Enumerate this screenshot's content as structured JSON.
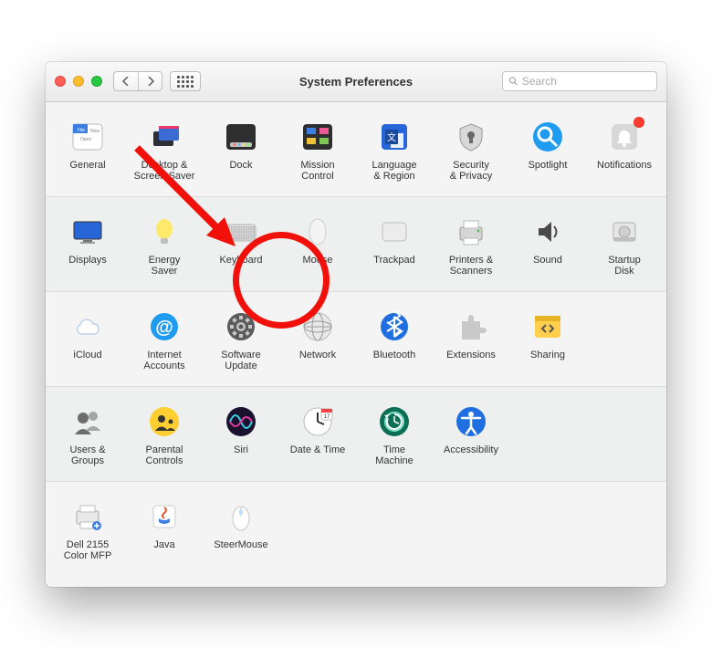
{
  "window": {
    "title": "System Preferences"
  },
  "search": {
    "placeholder": "Search"
  },
  "rows": [
    [
      {
        "key": "general",
        "label": "General"
      },
      {
        "key": "desktop",
        "label": "Desktop &\nScreen Saver"
      },
      {
        "key": "dock",
        "label": "Dock"
      },
      {
        "key": "mission",
        "label": "Mission\nControl"
      },
      {
        "key": "language",
        "label": "Language\n& Region"
      },
      {
        "key": "security",
        "label": "Security\n& Privacy"
      },
      {
        "key": "spotlight",
        "label": "Spotlight"
      },
      {
        "key": "notifications",
        "label": "Notifications",
        "badge": true
      }
    ],
    [
      {
        "key": "displays",
        "label": "Displays"
      },
      {
        "key": "energy",
        "label": "Energy\nSaver"
      },
      {
        "key": "keyboard",
        "label": "Keyboard"
      },
      {
        "key": "mouse",
        "label": "Mouse"
      },
      {
        "key": "trackpad",
        "label": "Trackpad"
      },
      {
        "key": "printers",
        "label": "Printers &\nScanners"
      },
      {
        "key": "sound",
        "label": "Sound"
      },
      {
        "key": "startup",
        "label": "Startup\nDisk"
      }
    ],
    [
      {
        "key": "icloud",
        "label": "iCloud"
      },
      {
        "key": "internet",
        "label": "Internet\nAccounts"
      },
      {
        "key": "software",
        "label": "Software\nUpdate"
      },
      {
        "key": "network",
        "label": "Network"
      },
      {
        "key": "bluetooth",
        "label": "Bluetooth"
      },
      {
        "key": "extensions",
        "label": "Extensions"
      },
      {
        "key": "sharing",
        "label": "Sharing"
      },
      {
        "key": "",
        "label": ""
      }
    ],
    [
      {
        "key": "users",
        "label": "Users &\nGroups"
      },
      {
        "key": "parental",
        "label": "Parental\nControls"
      },
      {
        "key": "siri",
        "label": "Siri"
      },
      {
        "key": "datetime",
        "label": "Date & Time"
      },
      {
        "key": "timemachine",
        "label": "Time\nMachine"
      },
      {
        "key": "accessibility",
        "label": "Accessibility"
      },
      {
        "key": "",
        "label": ""
      },
      {
        "key": "",
        "label": ""
      }
    ],
    [
      {
        "key": "dell",
        "label": "Dell 2155\nColor MFP"
      },
      {
        "key": "java",
        "label": "Java"
      },
      {
        "key": "steermouse",
        "label": "SteerMouse"
      },
      {
        "key": "",
        "label": ""
      },
      {
        "key": "",
        "label": ""
      },
      {
        "key": "",
        "label": ""
      },
      {
        "key": "",
        "label": ""
      },
      {
        "key": "",
        "label": ""
      }
    ]
  ],
  "annotation": {
    "highlighted_item": "keyboard"
  }
}
